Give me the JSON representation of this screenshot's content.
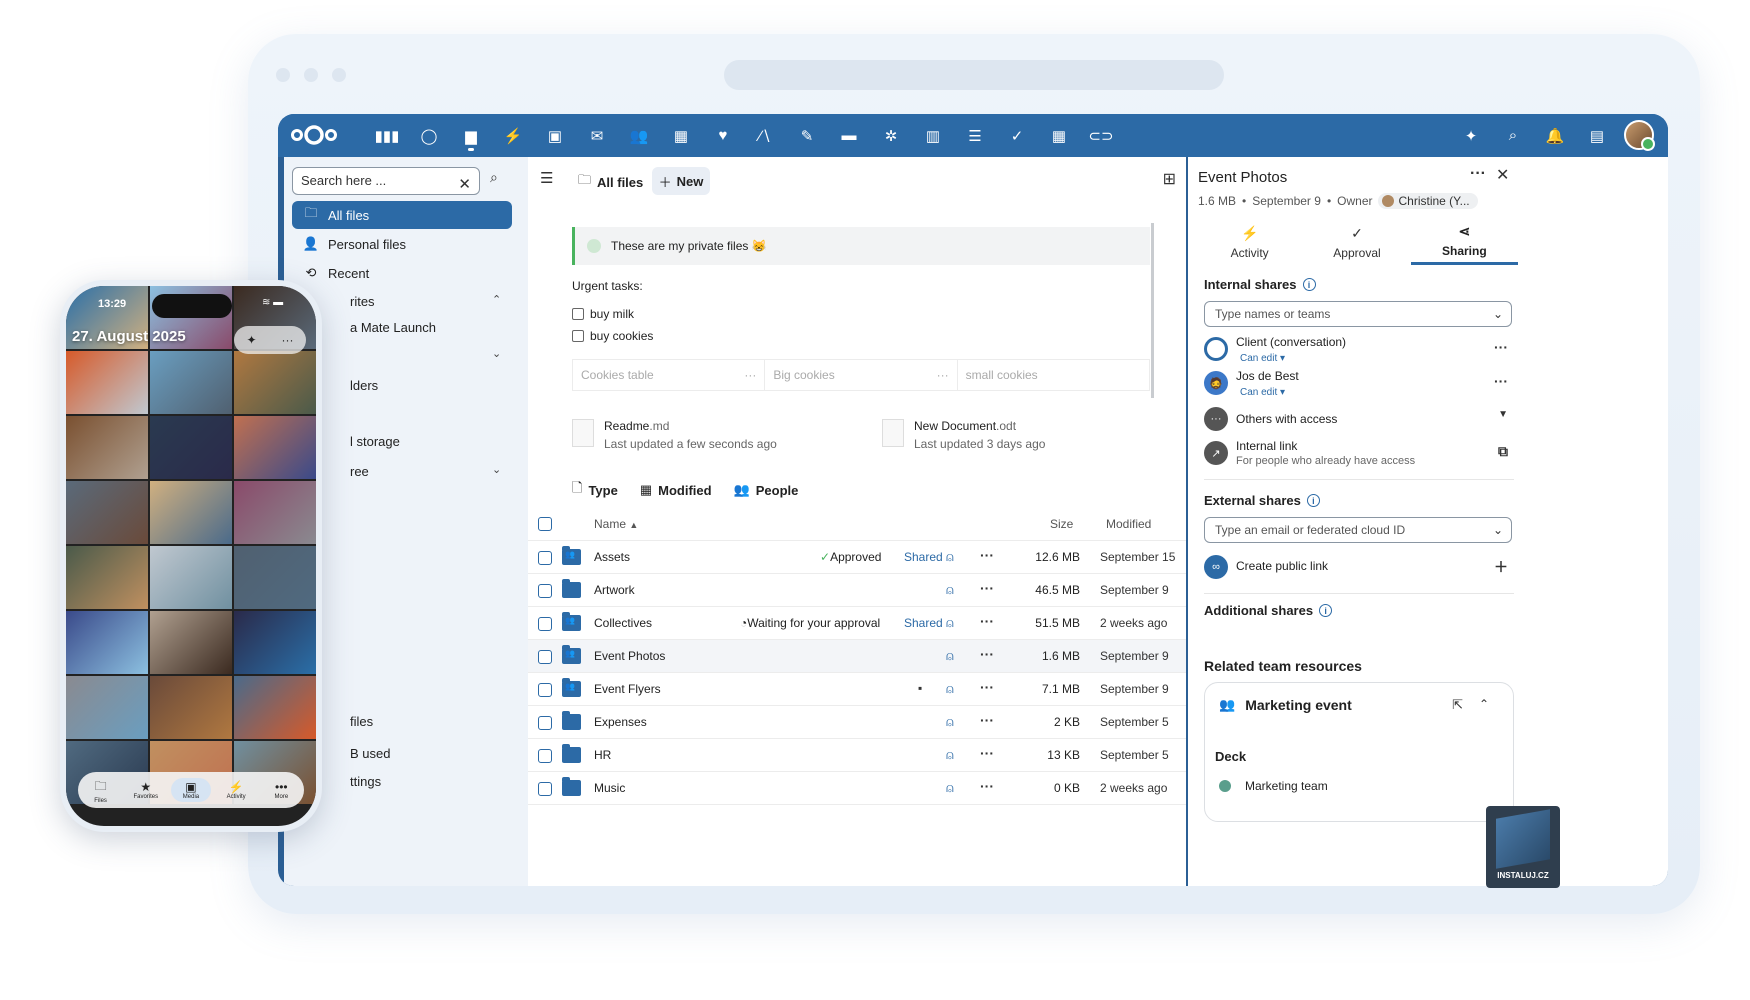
{
  "topbar": {
    "apps": [
      {
        "icon": "dashboard-icon",
        "glyph": "▮▮▮"
      },
      {
        "icon": "talk-icon",
        "glyph": "◯"
      },
      {
        "icon": "files-icon",
        "glyph": "▆",
        "active": true
      },
      {
        "icon": "activity-icon",
        "glyph": "⚡"
      },
      {
        "icon": "photos-icon",
        "glyph": "▣"
      },
      {
        "icon": "mail-icon",
        "glyph": "✉"
      },
      {
        "icon": "contacts-icon",
        "glyph": "👥"
      },
      {
        "icon": "calendar-icon",
        "glyph": "▦"
      },
      {
        "icon": "heart-icon",
        "glyph": "♥"
      },
      {
        "icon": "analytics-icon",
        "glyph": "∕∖"
      },
      {
        "icon": "edit-icon",
        "glyph": "✎"
      },
      {
        "icon": "deck-icon",
        "glyph": "▬"
      },
      {
        "icon": "flow-icon",
        "glyph": "✲"
      },
      {
        "icon": "charts-icon",
        "glyph": "▥"
      },
      {
        "icon": "list-icon",
        "glyph": "☰"
      },
      {
        "icon": "check-icon",
        "glyph": "✓"
      },
      {
        "icon": "table-icon",
        "glyph": "▦"
      },
      {
        "icon": "link-icon",
        "glyph": "⊂⊃"
      }
    ],
    "right": [
      {
        "icon": "assistant-icon",
        "glyph": "✦"
      },
      {
        "icon": "search-icon",
        "glyph": "⌕"
      },
      {
        "icon": "bell-icon",
        "glyph": "🔔"
      },
      {
        "icon": "contacts-menu-icon",
        "glyph": "▤"
      }
    ]
  },
  "nav": {
    "search_placeholder": "Search here ...",
    "items": [
      {
        "label": "All files",
        "icon": "🗀",
        "active": true
      },
      {
        "label": "Personal files",
        "icon": "👤"
      },
      {
        "label": "Recent",
        "icon": "⟲"
      },
      {
        "label": "rites",
        "icon": ""
      },
      {
        "label": "a Mate Launch",
        "icon": ""
      },
      {
        "label": "",
        "icon": ""
      },
      {
        "label": "lders",
        "icon": ""
      },
      {
        "label": "l storage",
        "icon": ""
      },
      {
        "label": "ree",
        "icon": ""
      },
      {
        "label": "files",
        "icon": ""
      },
      {
        "label": "B used",
        "icon": ""
      },
      {
        "label": "ttings",
        "icon": ""
      }
    ]
  },
  "main": {
    "breadcrumb": "All files",
    "new_label": "New",
    "note": "These are my private files 😸",
    "urgent": "Urgent tasks:",
    "tasks": [
      "buy milk",
      "buy cookies"
    ],
    "table_cells": [
      "Cookies table",
      "Big cookies",
      "small cookies"
    ],
    "recent": [
      {
        "name": "Readme",
        "ext": ".md",
        "sub": "Last updated a few seconds ago"
      },
      {
        "name": "New Document",
        "ext": ".odt",
        "sub": "Last updated 3 days ago"
      }
    ],
    "filters": [
      "Type",
      "Modified",
      "People"
    ],
    "col_name": "Name",
    "col_size": "Size",
    "col_modified": "Modified",
    "files": [
      {
        "name": "Assets",
        "shared": true,
        "status": "Approved",
        "shared_label": "Shared",
        "size": "12.6 MB",
        "modified": "September 15"
      },
      {
        "name": "Artwork",
        "shared": false,
        "status": "",
        "shared_label": "",
        "size": "46.5 MB",
        "modified": "September 9"
      },
      {
        "name": "Collectives",
        "shared": true,
        "status": "Waiting for your approval",
        "shared_label": "Shared",
        "size": "51.5 MB",
        "modified": "2 weeks ago"
      },
      {
        "name": "Event Photos",
        "shared": true,
        "status": "",
        "shared_label": "",
        "size": "1.6 MB",
        "modified": "September 9",
        "selected": true
      },
      {
        "name": "Event Flyers",
        "shared": true,
        "status": "",
        "shared_label": "",
        "size": "7.1 MB",
        "modified": "September 9",
        "comment": true
      },
      {
        "name": "Expenses",
        "shared": false,
        "status": "",
        "shared_label": "",
        "size": "2 KB",
        "modified": "September 5"
      },
      {
        "name": "HR",
        "shared": false,
        "status": "",
        "shared_label": "",
        "size": "13 KB",
        "modified": "September 5"
      },
      {
        "name": "Music",
        "shared": false,
        "status": "",
        "shared_label": "",
        "size": "0 KB",
        "modified": "2 weeks ago"
      }
    ]
  },
  "sidebar": {
    "title": "Event Photos",
    "size": "1.6 MB",
    "date": "September 9",
    "owner_label": "Owner",
    "owner_name": "Christine (Y...",
    "tabs": [
      {
        "label": "Activity",
        "icon": "⚡"
      },
      {
        "label": "Approval",
        "icon": "✓"
      },
      {
        "label": "Sharing",
        "icon": "⋖",
        "active": true
      }
    ],
    "internal_title": "Internal shares",
    "internal_placeholder": "Type names or teams",
    "shares": [
      {
        "name": "Client (conversation)",
        "perm": "Can edit"
      },
      {
        "name": "Jos de Best",
        "perm": "Can edit"
      }
    ],
    "others": "Others with access",
    "internal_link": "Internal link",
    "internal_link_sub": "For people who already have access",
    "external_title": "External shares",
    "external_placeholder": "Type an email or federated cloud ID",
    "public_link": "Create public link",
    "additional": "Additional shares",
    "related_title": "Related team resources",
    "team_name": "Marketing event",
    "deck_label": "Deck",
    "deck_item": "Marketing team"
  },
  "phone": {
    "time": "13:29",
    "date": "27. August 2025",
    "tabs": [
      {
        "label": "Files",
        "icon": "🗀"
      },
      {
        "label": "Favorites",
        "icon": "★"
      },
      {
        "label": "Media",
        "icon": "▣",
        "active": true
      },
      {
        "label": "Activity",
        "icon": "⚡"
      },
      {
        "label": "More",
        "icon": "•••"
      }
    ]
  },
  "badge": {
    "text": "INSTALUJ.CZ"
  },
  "colors": {
    "accent": "#2c6aa6",
    "approved": "#49b35e"
  }
}
